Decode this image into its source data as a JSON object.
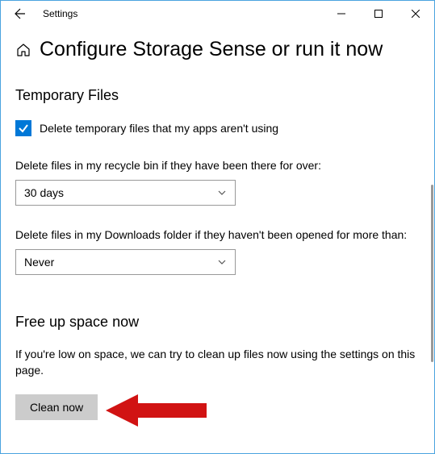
{
  "titlebar": {
    "title": "Settings"
  },
  "page": {
    "title": "Configure Storage Sense or run it now"
  },
  "tempFiles": {
    "sectionTitle": "Temporary Files",
    "checkboxLabel": "Delete temporary files that my apps aren't using",
    "recycleLabel": "Delete files in my recycle bin if they have been there for over:",
    "recycleValue": "30 days",
    "downloadsLabel": "Delete files in my Downloads folder if they haven't been opened for more than:",
    "downloadsValue": "Never"
  },
  "freeUp": {
    "sectionTitle": "Free up space now",
    "description": "If you're low on space, we can try to clean up files now using the settings on this page.",
    "buttonLabel": "Clean now"
  }
}
